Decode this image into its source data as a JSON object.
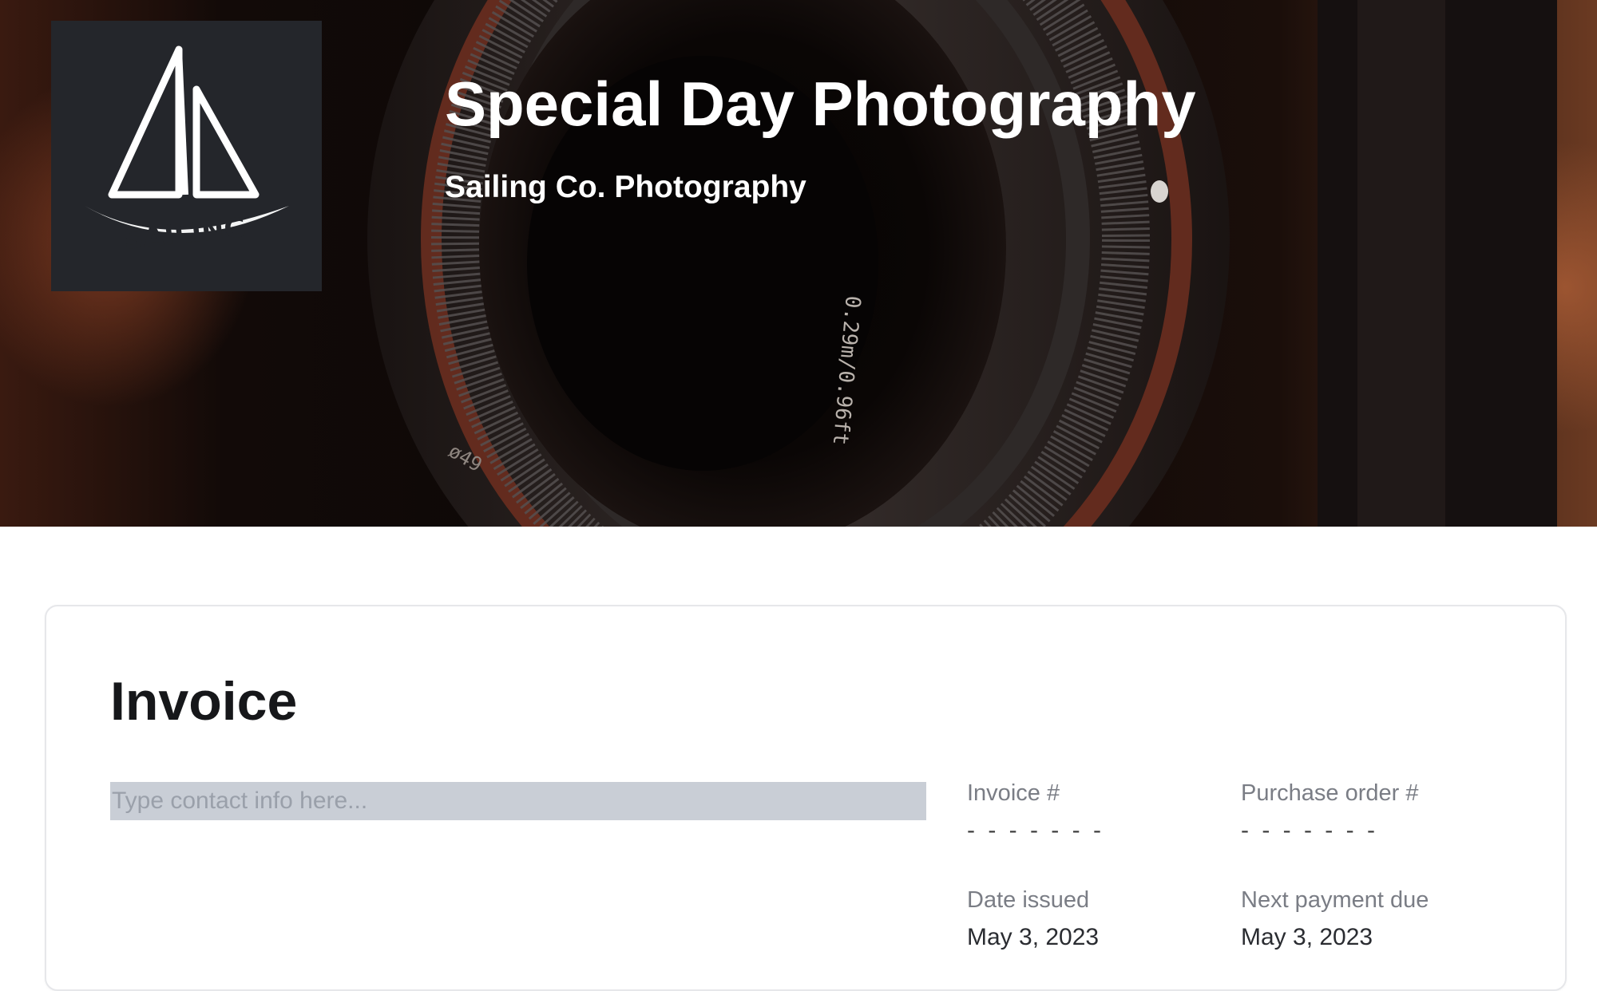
{
  "header": {
    "title": "Special Day Photography",
    "subtitle": "Sailing Co. Photography",
    "logo_text": "SAILING",
    "lens_markings": {
      "front": "0.29m/0.96ft",
      "ring": "ø49"
    }
  },
  "invoice": {
    "heading": "Invoice",
    "contact_placeholder": "Type contact info here...",
    "fields": {
      "invoice_number": {
        "label": "Invoice #",
        "value": "- - - - - - -"
      },
      "purchase_order": {
        "label": "Purchase order #",
        "value": "- - - - - - -"
      },
      "date_issued": {
        "label": "Date issued",
        "value": "May 3, 2023"
      },
      "next_payment_due": {
        "label": "Next payment due",
        "value": "May 3, 2023"
      }
    }
  },
  "colors": {
    "hero_overlay": "#0b0706",
    "logo_background": "#24262b",
    "card_border": "#e6e7ea",
    "input_highlight": "#c9ced6",
    "label_gray": "#7a7d85"
  }
}
